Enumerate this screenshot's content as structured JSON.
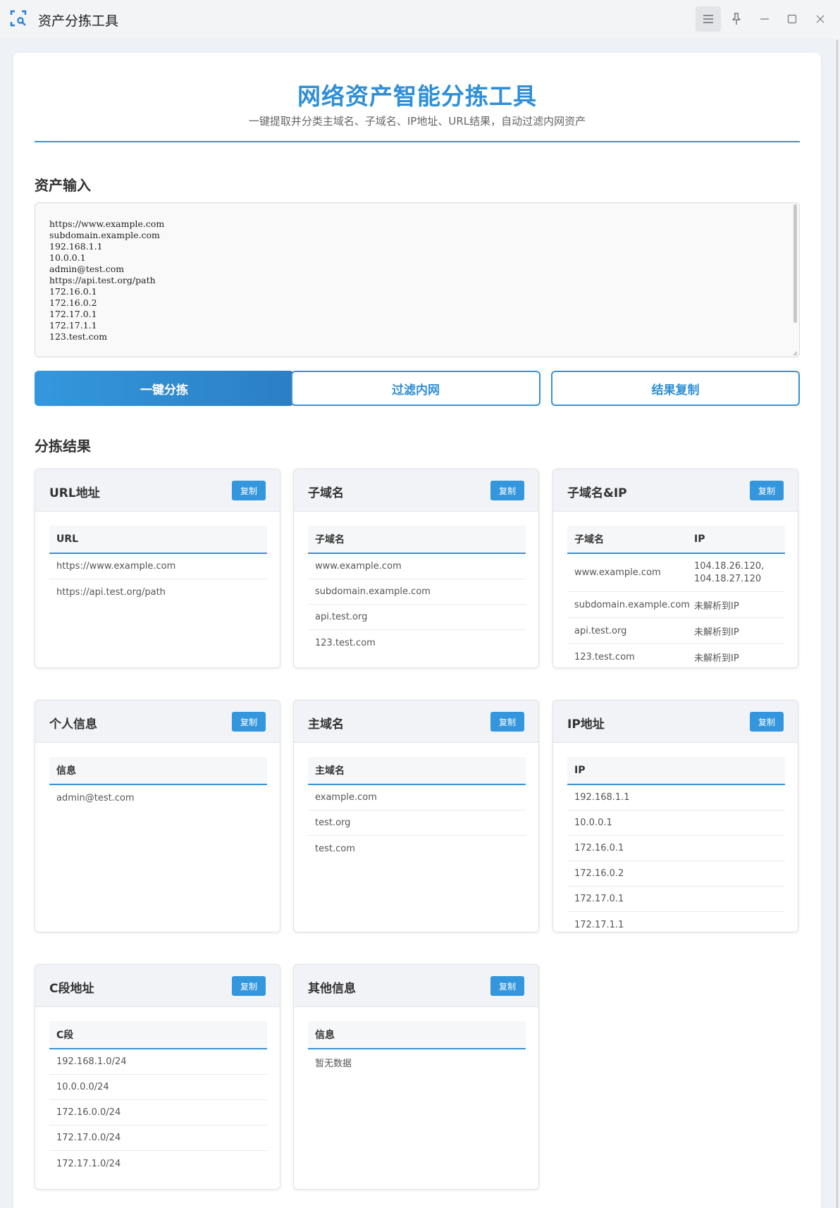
{
  "window": {
    "title": "资产分拣工具",
    "icons": [
      "scan-search-icon",
      "hamburger-icon",
      "pin-icon",
      "minimize-icon",
      "maximize-icon",
      "close-icon"
    ]
  },
  "header": {
    "title": "网络资产智能分拣工具",
    "subtitle": "一键提取并分类主域名、子域名、IP地址、URL结果，自动过滤内网资产"
  },
  "input": {
    "section_title": "资产输入",
    "value": "https://www.example.com\nsubdomain.example.com\n192.168.1.1\n10.0.0.1\nadmin@test.com\nhttps://api.test.org/path\n172.16.0.1\n172.16.0.2\n172.17.0.1\n172.17.1.1\n123.test.com"
  },
  "actions": {
    "sort": "一键分拣",
    "filter": "过滤内网",
    "copy": "结果复制"
  },
  "results": {
    "section_title": "分拣结果",
    "copy_label": "复制",
    "url": {
      "title": "URL地址",
      "header": "URL",
      "rows": [
        "https://www.example.com",
        "https://api.test.org/path"
      ]
    },
    "subdomain": {
      "title": "子域名",
      "header": "子域名",
      "rows": [
        "www.example.com",
        "subdomain.example.com",
        "api.test.org",
        "123.test.com"
      ]
    },
    "subdomain_ip": {
      "title": "子域名&IP",
      "headers": [
        "子域名",
        "IP"
      ],
      "rows": [
        {
          "domain": "www.example.com",
          "ip_line1": "104.18.26.120,",
          "ip_line2": "104.18.27.120"
        },
        {
          "domain": "subdomain.example.com",
          "ip": "未解析到IP"
        },
        {
          "domain": "api.test.org",
          "ip": "未解析到IP"
        },
        {
          "domain": "123.test.com",
          "ip": "未解析到IP"
        }
      ]
    },
    "personal": {
      "title": "个人信息",
      "header": "信息",
      "rows": [
        "admin@test.com"
      ]
    },
    "main_domain": {
      "title": "主域名",
      "header": "主域名",
      "rows": [
        "example.com",
        "test.org",
        "test.com"
      ]
    },
    "ip": {
      "title": "IP地址",
      "header": "IP",
      "rows": [
        "192.168.1.1",
        "10.0.0.1",
        "172.16.0.1",
        "172.16.0.2",
        "172.17.0.1",
        "172.17.1.1"
      ]
    },
    "c_segment": {
      "title": "C段地址",
      "header": "C段",
      "rows": [
        "192.168.1.0/24",
        "10.0.0.0/24",
        "172.16.0.0/24",
        "172.17.0.0/24",
        "172.17.1.0/24"
      ]
    },
    "other": {
      "title": "其他信息",
      "header": "信息",
      "rows": [
        "暂无数据"
      ]
    }
  }
}
